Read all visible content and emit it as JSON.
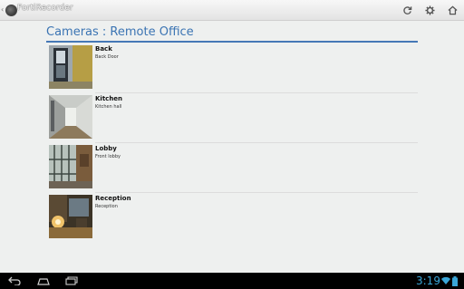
{
  "app": {
    "title": "FortiRecorder"
  },
  "actionbar": {
    "icons": [
      "refresh-icon",
      "gear-icon",
      "home-icon"
    ]
  },
  "page": {
    "heading": "Cameras : Remote Office"
  },
  "cameras": [
    {
      "name": "Back",
      "description": "Back Door"
    },
    {
      "name": "Kitchen",
      "description": "Kitchen hall"
    },
    {
      "name": "Lobby",
      "description": "Front lobby"
    },
    {
      "name": "Reception",
      "description": "Reception"
    }
  ],
  "navbar": {
    "icons": [
      "back-icon",
      "home-icon",
      "recent-apps-icon"
    ],
    "clock": "3:19",
    "status_icons": [
      "wifi-icon",
      "battery-icon"
    ]
  },
  "colors": {
    "accent": "#3b74b3",
    "clock": "#3aa6d8"
  }
}
